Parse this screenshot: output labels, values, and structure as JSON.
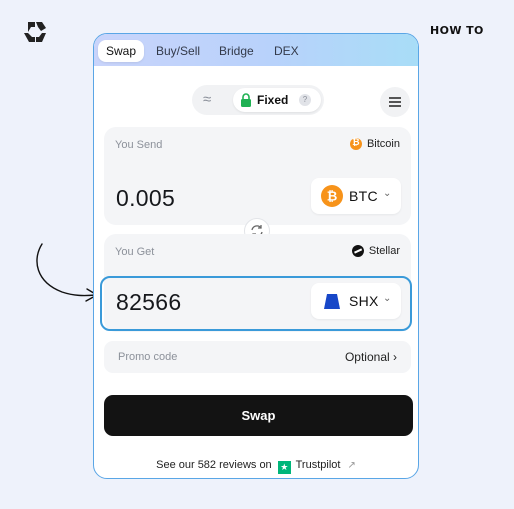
{
  "header": {
    "how_to": "HOW TO"
  },
  "tabs": [
    {
      "label": "Swap",
      "active": true
    },
    {
      "label": "Buy/Sell",
      "active": false
    },
    {
      "label": "Bridge",
      "active": false
    },
    {
      "label": "DEX",
      "active": false
    }
  ],
  "mode": {
    "floating_icon": "≈",
    "fixed_label": "Fixed",
    "help": "?"
  },
  "send": {
    "label": "You Send",
    "network": "Bitcoin",
    "amount": "0.005",
    "asset": "BTC",
    "asset_icon": "bitcoin-icon",
    "chevron": "⌄"
  },
  "get": {
    "label": "You Get",
    "network": "Stellar",
    "amount": "82566",
    "asset": "SHX",
    "asset_icon": "stronghold-icon",
    "chevron": "⌄"
  },
  "promo": {
    "label": "Promo code",
    "optional": "Optional ›"
  },
  "swap_button": {
    "label": "Swap"
  },
  "trustpilot": {
    "prefix": "See our 582 reviews on",
    "brand": "Trustpilot",
    "star": "★",
    "ext": "↗"
  },
  "colors": {
    "accent": "#3a9ad9",
    "bitcoin": "#f7931a",
    "trustpilot": "#00b67a",
    "shx": "#1747c8"
  }
}
